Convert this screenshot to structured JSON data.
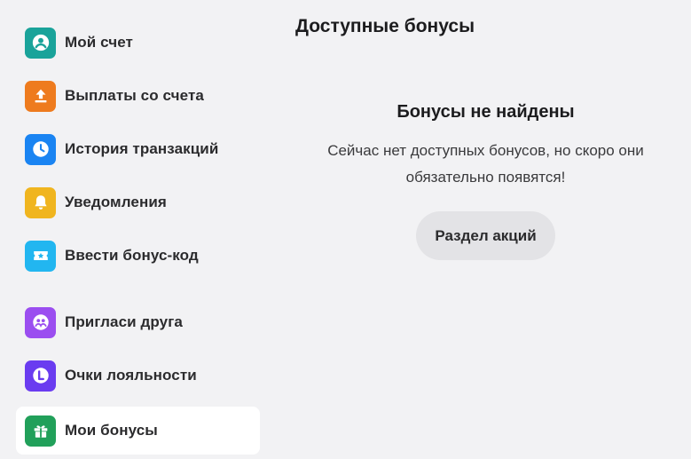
{
  "sidebar": {
    "items": [
      {
        "label": "Мой счет",
        "icon": "user-icon",
        "color": "#1aa39a"
      },
      {
        "label": "Выплаты со счета",
        "icon": "upload-icon",
        "color": "#ee7b1e"
      },
      {
        "label": "История транзакций",
        "icon": "clock-icon",
        "color": "#1a84f2"
      },
      {
        "label": "Уведомления",
        "icon": "bell-icon",
        "color": "#f0b51f"
      },
      {
        "label": "Ввести бонус-код",
        "icon": "ticket-icon",
        "color": "#22b6f0"
      },
      {
        "label": "Пригласи друга",
        "icon": "friends-icon",
        "color": "#9b4ef0"
      },
      {
        "label": "Очки лояльности",
        "icon": "loyalty-icon",
        "color": "#6a3cf0"
      },
      {
        "label": "Мои бонусы",
        "icon": "gift-icon",
        "color": "#21a05a",
        "active": true
      }
    ]
  },
  "main": {
    "title": "Доступные бонусы",
    "empty_title": "Бонусы не найдены",
    "empty_text": "Сейчас нет доступных бонусов, но скоро они обязательно появятся!",
    "button_label": "Раздел акций"
  }
}
